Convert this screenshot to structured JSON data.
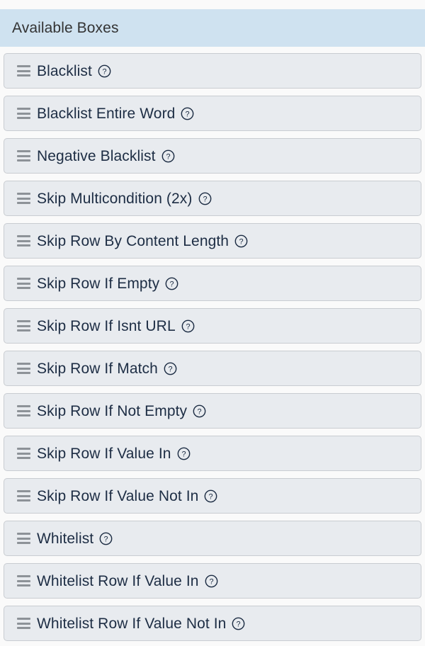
{
  "panel": {
    "header_title": "Available Boxes"
  },
  "icons": {
    "drag_handle": "hamburger-drag-handle-icon",
    "help": "question-mark-circle-icon"
  },
  "colors": {
    "page_background": "#fafafa",
    "header_background": "#cfe2f0",
    "header_text": "#333333",
    "item_background": "#e8ebef",
    "item_border": "#c9ccd1",
    "item_text": "#1d2d44",
    "handle_color": "#8d9298"
  },
  "boxes": [
    {
      "label": "Blacklist"
    },
    {
      "label": "Blacklist Entire Word"
    },
    {
      "label": "Negative Blacklist"
    },
    {
      "label": "Skip Multicondition (2x)"
    },
    {
      "label": "Skip Row By Content Length"
    },
    {
      "label": "Skip Row If Empty"
    },
    {
      "label": "Skip Row If Isnt URL"
    },
    {
      "label": "Skip Row If Match"
    },
    {
      "label": "Skip Row If Not Empty"
    },
    {
      "label": "Skip Row If Value In"
    },
    {
      "label": "Skip Row If Value Not In"
    },
    {
      "label": "Whitelist"
    },
    {
      "label": "Whitelist Row If Value In"
    },
    {
      "label": "Whitelist Row If Value Not In"
    }
  ]
}
